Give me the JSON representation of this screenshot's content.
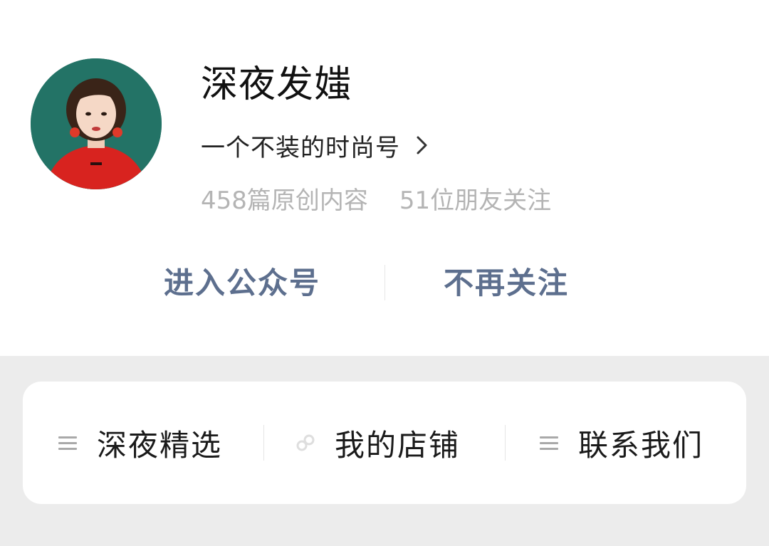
{
  "profile": {
    "name": "深夜发媸",
    "description": "一个不装的时尚号",
    "stats": {
      "articles": "458篇原创内容",
      "followers": "51位朋友关注"
    }
  },
  "actions": {
    "enter": "进入公众号",
    "unfollow": "不再关注"
  },
  "menu": {
    "items": [
      {
        "label": "深夜精选",
        "icon": "menu-lines-icon"
      },
      {
        "label": "我的店铺",
        "icon": "mini-program-link-icon"
      },
      {
        "label": "联系我们",
        "icon": "menu-lines-icon"
      }
    ]
  },
  "colors": {
    "action_text": "#5d6f8e",
    "stats_text": "#b4b4b4",
    "background": "#ececec",
    "avatar_bg": "#1f6e62",
    "shirt": "#d8231f"
  }
}
